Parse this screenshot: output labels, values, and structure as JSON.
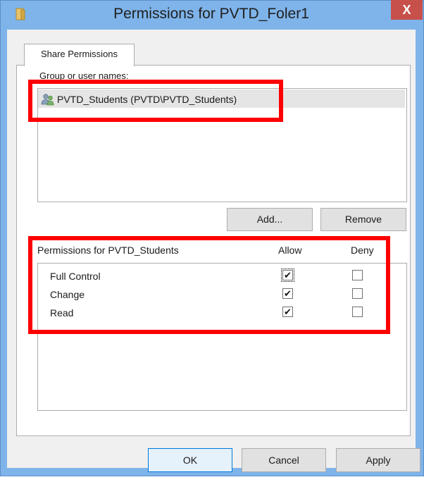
{
  "window": {
    "title": "Permissions for PVTD_Foler1",
    "close_label": "X"
  },
  "tabs": [
    {
      "label": "Share Permissions"
    }
  ],
  "groups": {
    "label": "Group or user names:",
    "items": [
      {
        "name": "PVTD_Students (PVTD\\PVTD_Students)",
        "icon": "users-icon"
      }
    ],
    "add_label": "Add...",
    "remove_label": "Remove"
  },
  "permissions": {
    "label": "Permissions for PVTD_Students",
    "allow_header": "Allow",
    "deny_header": "Deny",
    "rows": [
      {
        "name": "Full Control",
        "allow": true,
        "deny": false
      },
      {
        "name": "Change",
        "allow": true,
        "deny": false
      },
      {
        "name": "Read",
        "allow": true,
        "deny": false
      }
    ]
  },
  "footer": {
    "ok_label": "OK",
    "cancel_label": "Cancel",
    "apply_label": "Apply"
  },
  "colors": {
    "titlebar": "#7eb4ea",
    "close": "#c7504b",
    "highlight": "#ff0000"
  }
}
